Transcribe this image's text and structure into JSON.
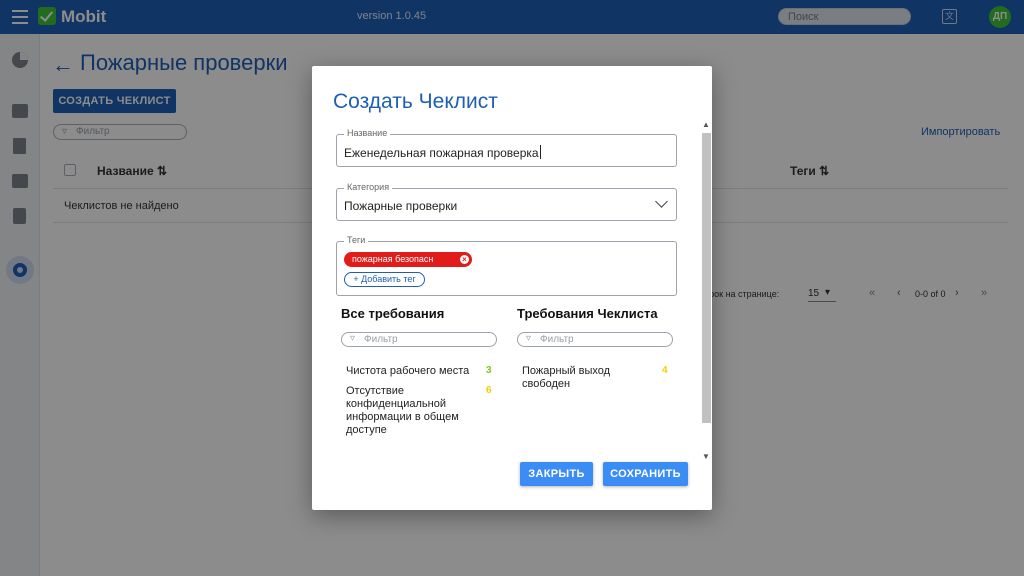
{
  "app": {
    "name": "Mobit",
    "version": "version 1.0.45",
    "search_placeholder": "Поиск",
    "avatar_initials": "ДП",
    "brand_color": "#1e5fb5",
    "logo_color": "#3ec53a"
  },
  "page": {
    "title": "Пожарные проверки",
    "create_button": "СОЗДАТЬ ЧЕКЛИСТ",
    "filter_placeholder": "Фильтр",
    "import_link": "Импортировать",
    "columns": [
      "Название",
      "Теги"
    ],
    "empty_message": "Чеклистов не найдено",
    "pagination": {
      "rows_label": "трок на странице:",
      "page_size": "15",
      "range": "0-0 of 0"
    }
  },
  "modal": {
    "title": "Создать Чеклист",
    "name_field": {
      "label": "Название",
      "value": "Еженедельная пожарная проверка"
    },
    "category_field": {
      "label": "Категория",
      "value": "Пожарные проверки"
    },
    "tags_field": {
      "label": "Теги",
      "tags": [
        "пожарная безопасн"
      ],
      "tag_color": "#e21b1b",
      "add_label": "+ Добавить тег"
    },
    "all_requirements": {
      "title": "Все требования",
      "filter_placeholder": "Фильтр",
      "items": [
        {
          "label": "Чистота рабочего места",
          "count": "3",
          "count_color": "#7cc91a"
        },
        {
          "label": "Отсутствие конфиденциальной информации в общем доступе",
          "count": "6",
          "count_color": "#f0d000"
        }
      ]
    },
    "checklist_requirements": {
      "title": "Требования Чеклиста",
      "filter_placeholder": "Фильтр",
      "items": [
        {
          "label": "Пожарный выход свободен",
          "count": "4",
          "count_color": "#f0d000"
        }
      ]
    },
    "close_button": "ЗАКРЫТЬ",
    "save_button": "СОХРАНИТЬ"
  }
}
